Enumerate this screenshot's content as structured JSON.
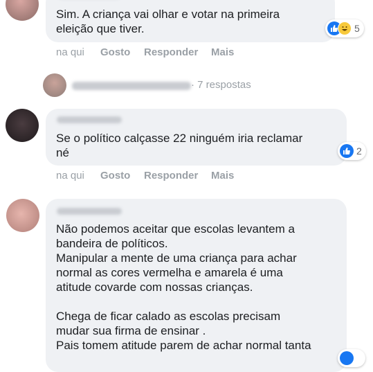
{
  "comments": [
    {
      "text": "Sim. A criança vai olhar e votar na primeira\neleição que tiver.",
      "reactions": {
        "icons": [
          "like-icon",
          "haha-icon"
        ],
        "count": "5"
      },
      "actions": {
        "time": "na qui",
        "like": "Gosto",
        "reply": "Responder",
        "more": "Mais"
      }
    },
    {
      "text": "Se o político calçasse 22 ninguém iria reclamar\nné",
      "reactions": {
        "icons": [
          "like-icon"
        ],
        "count": "2"
      },
      "actions": {
        "time": "na qui",
        "like": "Gosto",
        "reply": "Responder",
        "more": "Mais"
      }
    },
    {
      "text": "Não podemos aceitar que escolas levantem a\nbandeira de políticos.\nManipular a mente de uma criança para achar\nnormal as cores vermelha e amarela é uma\natitude covarde com nossas crianças.\n\nChega de ficar calado as escolas precisam\nmudar sua firma de ensinar .\nPais tomem atitude parem de achar normal tanta"
    }
  ],
  "replies_link": {
    "text": "· 7 respostas"
  },
  "colors": {
    "like": "#1877f2",
    "haha": "#f7c93b",
    "bubble": "#eff1f4",
    "meta": "#9aa0a6"
  }
}
